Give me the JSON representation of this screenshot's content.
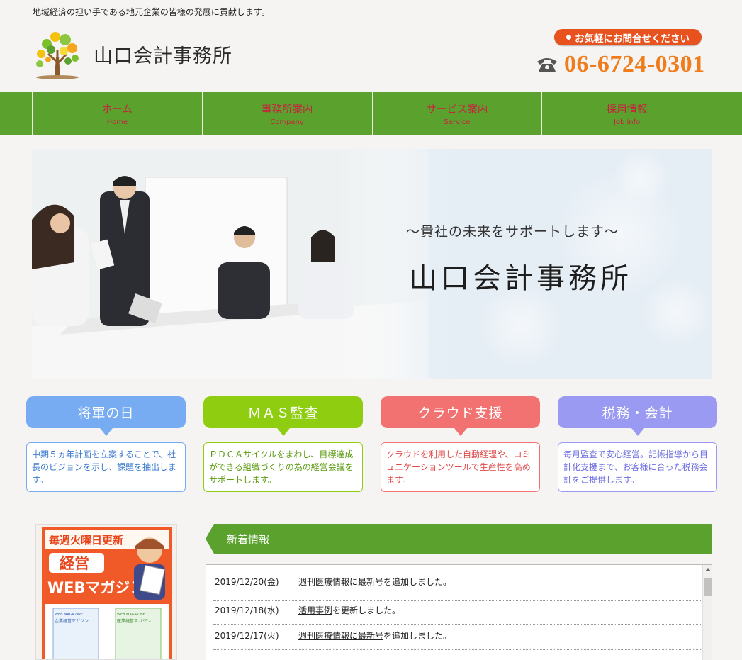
{
  "header": {
    "tagline": "地域経済の担い手である地元企業の皆様の発展に貢献します。",
    "logo_text": "山口会計事務所",
    "contact_label": "お気軽にお問合せください",
    "phone": "06-6724-0301"
  },
  "nav": [
    {
      "label": "ホーム",
      "sub": "Home"
    },
    {
      "label": "事務所案内",
      "sub": "Company"
    },
    {
      "label": "サービス案内",
      "sub": "Service"
    },
    {
      "label": "採用情報",
      "sub": "Job info"
    }
  ],
  "hero": {
    "subtitle": "～貴社の未来をサポートします～",
    "title": "山口会計事務所"
  },
  "services": [
    {
      "title": "将軍の日",
      "text": "中期５ヵ年計画を立案することで、社長のビジョンを示し、課題を抽出します。",
      "color": "#78acf2",
      "text_color": "#3d7bd0"
    },
    {
      "title": "ＭＡＳ監査",
      "text": "ＰＤＣＡサイクルをまわし、目標達成ができる組織づくりの為の経営会議をサポートします。",
      "color": "#8fcd11",
      "text_color": "#5a9a0c"
    },
    {
      "title": "クラウド支援",
      "text": "クラウドを利用した自動経理や、コミュニケーションツールで生産性を高めます。",
      "color": "#f27272",
      "text_color": "#e04b4b"
    },
    {
      "title": "税務・会計",
      "text": "毎月監査で安心経営。記帳指導から目計化支援まで、お客様に合った税務会計をご提供します。",
      "color": "#9a9af2",
      "text_color": "#6e6ee0"
    }
  ],
  "magazine": {
    "banner": "毎週火曜日更新",
    "title1": "経営",
    "title2": "WEBマガジン",
    "tag1": "WEB MAGAZINE",
    "book1": "企業経営マガジン",
    "book2": "医業経営マガジン"
  },
  "news": {
    "title": "新着情報",
    "items": [
      {
        "date": "2019/12/20(金)",
        "link": "週刊医療情報に最新号",
        "rest": "を追加しました。"
      },
      {
        "date": "2019/12/18(水)",
        "link": "活用事例",
        "rest": "を更新しました。"
      },
      {
        "date": "2019/12/17(火)",
        "link": "週刊医療情報に最新号",
        "rest": "を追加しました。"
      }
    ]
  }
}
